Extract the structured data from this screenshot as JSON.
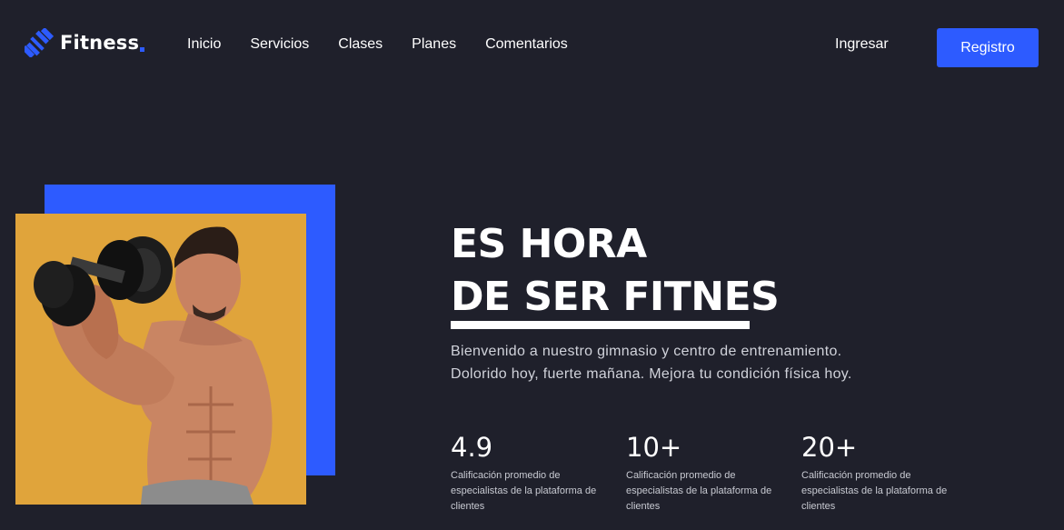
{
  "brand": {
    "name": "Fitness",
    "accent": "#2d5bff",
    "logo_icon": "dumbbell-icon"
  },
  "nav": {
    "items": [
      {
        "label": "Inicio"
      },
      {
        "label": "Servicios"
      },
      {
        "label": "Clases"
      },
      {
        "label": "Planes"
      },
      {
        "label": "Comentarios"
      }
    ],
    "login_label": "Ingresar",
    "register_label": "Registro"
  },
  "hero": {
    "title_line1": "ES HORA",
    "title_line2": "DE SER FITNES",
    "desc_line1": "Bienvenido a nuestro gimnasio y centro de entrenamiento.",
    "desc_line2": "Dolorido hoy, fuerte mañana. Mejora tu condición física hoy.",
    "image": "man-lifting-dumbbell-photo"
  },
  "stats": [
    {
      "value": "4.9",
      "desc": "Calificación promedio de especialistas de la plataforma de clientes"
    },
    {
      "value": "10+",
      "desc": "Calificación promedio de especialistas de la plataforma de clientes"
    },
    {
      "value": "20+",
      "desc": "Calificación promedio de especialistas de la plataforma de clientes"
    }
  ],
  "colors": {
    "background": "#1f202b",
    "accent": "#2d5bff",
    "photo_bg": "#e0a43b"
  }
}
